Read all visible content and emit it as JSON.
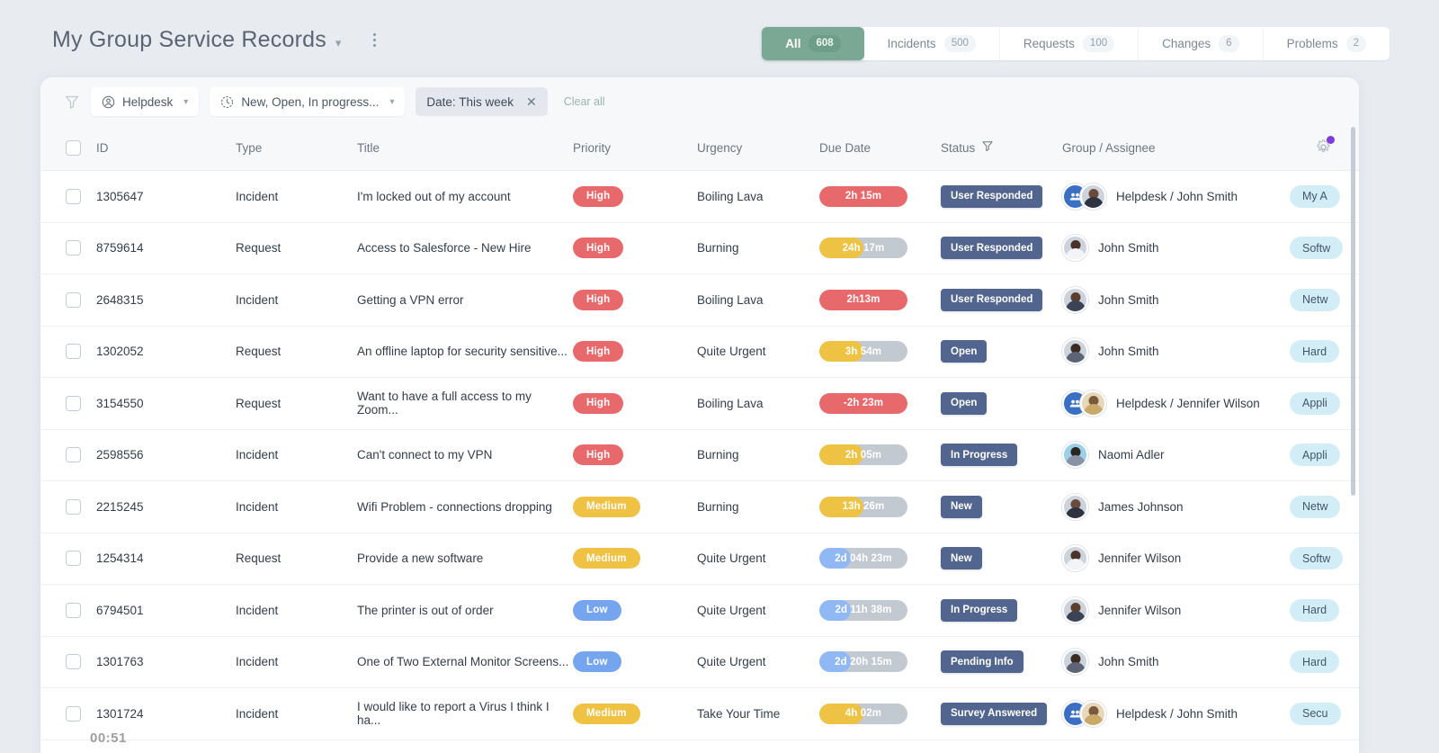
{
  "header": {
    "title": "My Group Service Records",
    "title_chevron_icon": "chevron-down-icon",
    "kebab_icon": "more-vertical-icon"
  },
  "tabs": [
    {
      "label": "All",
      "count": "608",
      "active": true
    },
    {
      "label": "Incidents",
      "count": "500",
      "active": false
    },
    {
      "label": "Requests",
      "count": "100",
      "active": false
    },
    {
      "label": "Changes",
      "count": "6",
      "active": false
    },
    {
      "label": "Problems",
      "count": "2",
      "active": false
    }
  ],
  "filterbar": {
    "funnel_icon": "filter-funnel-icon",
    "group_filter": {
      "label": "Helpdesk",
      "icon": "user-circle-icon"
    },
    "status_filter": {
      "label": "New, Open, In progress...",
      "icon": "clock-icon"
    },
    "date_filter": {
      "label": "Date: This week",
      "remove_icon": "close-icon"
    },
    "clear_all": "Clear all"
  },
  "table": {
    "columns": [
      {
        "key": "checkbox",
        "label": ""
      },
      {
        "key": "id",
        "label": "ID"
      },
      {
        "key": "type",
        "label": "Type"
      },
      {
        "key": "title",
        "label": "Title"
      },
      {
        "key": "priority",
        "label": "Priority"
      },
      {
        "key": "urgency",
        "label": "Urgency"
      },
      {
        "key": "due",
        "label": "Due Date"
      },
      {
        "key": "status",
        "label": "Status"
      },
      {
        "key": "group",
        "label": "Group / Assignee"
      },
      {
        "key": "category",
        "label": ""
      }
    ],
    "status_filter_icon": "filter-funnel-icon",
    "settings_icon": "gear-icon",
    "settings_badge": true,
    "rows": [
      {
        "id": "1305647",
        "type": "Incident",
        "title": "I'm locked out of my account",
        "priority": "High",
        "urgency": "Boiling Lava",
        "due": "2h 15m",
        "due_fill": "red",
        "due_pct": 100,
        "status": "User Responded",
        "group": "Helpdesk / John Smith",
        "is_group": true,
        "category": "My A"
      },
      {
        "id": "8759614",
        "type": "Request",
        "title": "Access to Salesforce - New Hire",
        "priority": "High",
        "urgency": "Burning",
        "due": "24h 17m",
        "due_fill": "yellow",
        "due_pct": 50,
        "status": "User Responded",
        "group": "John Smith",
        "is_group": false,
        "category": "Softw"
      },
      {
        "id": "2648315",
        "type": "Incident",
        "title": "Getting a VPN error",
        "priority": "High",
        "urgency": "Boiling Lava",
        "due": "2h13m",
        "due_fill": "red",
        "due_pct": 100,
        "status": "User Responded",
        "group": "John Smith",
        "is_group": false,
        "category": "Netw"
      },
      {
        "id": "1302052",
        "type": "Request",
        "title": "An offline laptop for security sensitive...",
        "priority": "High",
        "urgency": "Quite Urgent",
        "due": "3h 54m",
        "due_fill": "yellow",
        "due_pct": 50,
        "status": "Open",
        "group": "John Smith",
        "is_group": false,
        "category": "Hard"
      },
      {
        "id": "3154550",
        "type": "Request",
        "title": "Want to have a full access to my Zoom...",
        "priority": "High",
        "urgency": "Boiling Lava",
        "due": "-2h 23m",
        "due_fill": "red",
        "due_pct": 100,
        "status": "Open",
        "group": "Helpdesk / Jennifer Wilson",
        "is_group": true,
        "category": "Appli"
      },
      {
        "id": "2598556",
        "type": "Incident",
        "title": "Can't connect to my VPN",
        "priority": "High",
        "urgency": "Burning",
        "due": "2h 05m",
        "due_fill": "yellow",
        "due_pct": 50,
        "status": "In Progress",
        "group": "Naomi Adler",
        "is_group": false,
        "category": "Appli"
      },
      {
        "id": "2215245",
        "type": "Incident",
        "title": "Wifi Problem - connections dropping",
        "priority": "Medium",
        "urgency": "Burning",
        "due": "13h 26m",
        "due_fill": "yellow",
        "due_pct": 50,
        "status": "New",
        "group": "James Johnson",
        "is_group": false,
        "category": "Netw"
      },
      {
        "id": "1254314",
        "type": "Request",
        "title": "Provide a new software",
        "priority": "Medium",
        "urgency": "Quite Urgent",
        "due": "2d 04h 23m",
        "due_fill": "blue",
        "due_pct": 36,
        "status": "New",
        "group": "Jennifer Wilson",
        "is_group": false,
        "category": "Softw"
      },
      {
        "id": "6794501",
        "type": "Incident",
        "title": "The printer is out of order",
        "priority": "Low",
        "urgency": "Quite Urgent",
        "due": "2d 11h 38m",
        "due_fill": "blue",
        "due_pct": 36,
        "status": "In Progress",
        "group": "Jennifer Wilson",
        "is_group": false,
        "category": "Hard"
      },
      {
        "id": "1301763",
        "type": "Incident",
        "title": "One of Two External Monitor Screens...",
        "priority": "Low",
        "urgency": "Quite Urgent",
        "due": "2d 20h 15m",
        "due_fill": "blue",
        "due_pct": 36,
        "status": "Pending Info",
        "group": "John Smith",
        "is_group": false,
        "category": "Hard"
      },
      {
        "id": "1301724",
        "type": "Incident",
        "title": "I would like to report a Virus I think I ha...",
        "priority": "Medium",
        "urgency": "Take Your Time",
        "due": "4h 02m",
        "due_fill": "yellow",
        "due_pct": 50,
        "status": "Survey Answered",
        "group": "Helpdesk / John Smith",
        "is_group": true,
        "category": "Secu"
      }
    ]
  },
  "overlay": {
    "timer": "00:51"
  },
  "colors": {
    "accent_green": "#7aa894",
    "priority_high": "#e8696b",
    "priority_medium": "#f0c244",
    "priority_low": "#76a5f0",
    "status_badge": "#51658f",
    "category_tag": "#d3edf7",
    "settings_badge": "#7c3ddb",
    "page_background": "#e8ecf1"
  }
}
